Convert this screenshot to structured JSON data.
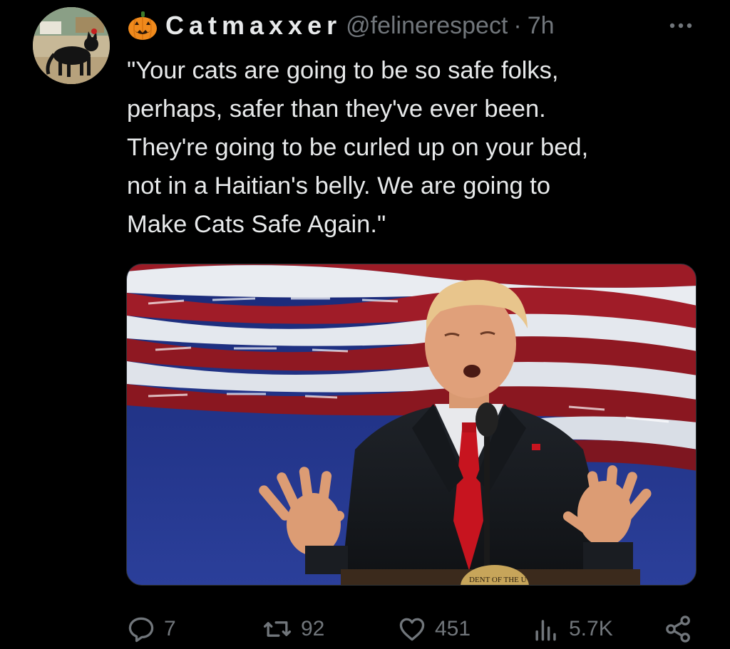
{
  "author": {
    "display_name": "Catmaxxer",
    "handle": "@felinerespect",
    "separator": "·",
    "time": "7h"
  },
  "icons": {
    "avatar": "black-cat-avatar",
    "name_emoji": "jack-o-lantern-icon",
    "more": "more-horizontal-icon"
  },
  "tweet": {
    "lines": [
      "\"Your cats are going to be so safe folks,",
      "perhaps, safer than they've ever been.",
      "They're going to be curled up on your bed,",
      "not in a Haitian's belly. We are going to",
      "Make Cats Safe Again.\""
    ]
  },
  "media": {
    "podium_seal_text": "DENT OF THE U"
  },
  "actions": {
    "reply": "7",
    "repost": "92",
    "like": "451",
    "views": "5.7K"
  },
  "colors": {
    "background": "#000000",
    "text": "#e7e9ea",
    "muted": "#71767b",
    "pumpkin": "#f08a1c"
  }
}
